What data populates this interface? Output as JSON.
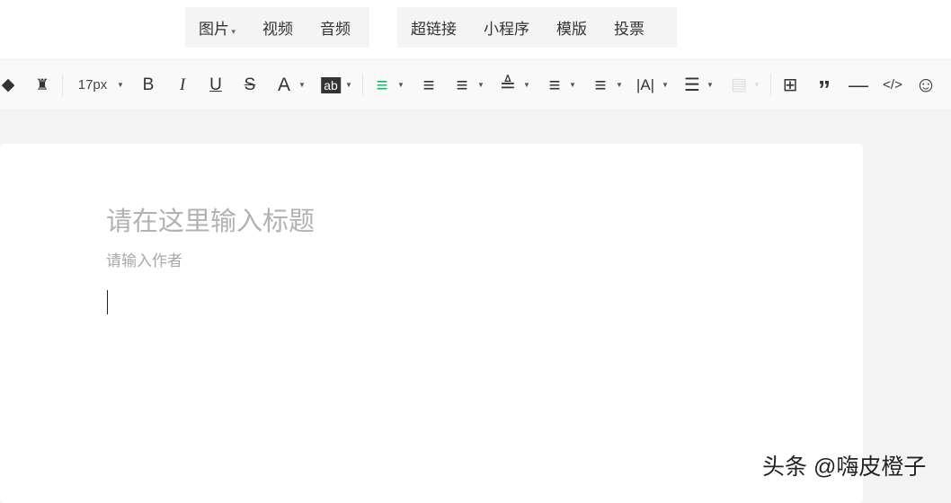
{
  "top_menu": {
    "group1": [
      "图片",
      "视频",
      "音频"
    ],
    "group2": [
      "超链接",
      "小程序",
      "模版",
      "投票"
    ]
  },
  "toolbar": {
    "font_size": "17px",
    "bold": "B",
    "italic": "I",
    "underline": "U",
    "strike": "S",
    "font_color": "A",
    "highlight": "ab",
    "letter_spacing": "|A|",
    "code": "</>"
  },
  "editor": {
    "title_placeholder": "请在这里输入标题",
    "author_placeholder": "请输入作者"
  },
  "watermark": "头条 @嗨皮橙子",
  "colors": {
    "accent": "#07c160"
  }
}
